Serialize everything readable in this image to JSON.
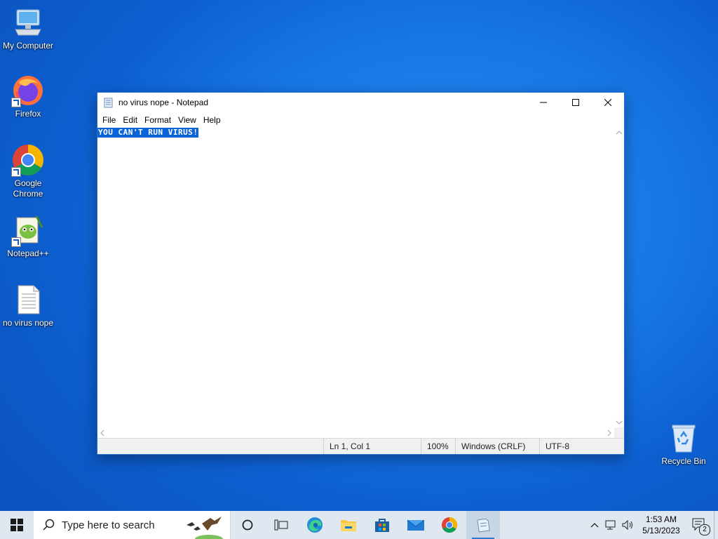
{
  "desktop": {
    "icons": [
      {
        "label": "My Computer"
      },
      {
        "label": "Firefox"
      },
      {
        "label": "Google Chrome"
      },
      {
        "label": "Notepad++"
      },
      {
        "label": "no virus nope"
      },
      {
        "label": "Recycle Bin"
      }
    ]
  },
  "notepad": {
    "title": "no virus nope - Notepad",
    "menu": [
      "File",
      "Edit",
      "Format",
      "View",
      "Help"
    ],
    "content": "YOU CAN'T RUN VIRUS!",
    "status": {
      "position": "Ln 1, Col 1",
      "zoom": "100%",
      "line_ending": "Windows (CRLF)",
      "encoding": "UTF-8"
    }
  },
  "taskbar": {
    "search_placeholder": "Type here to search",
    "clock_time": "1:53 AM",
    "clock_date": "5/13/2023",
    "notification_count": "2"
  },
  "colors": {
    "selection": "#0a64d7",
    "desktop": "#1877e6",
    "taskbar": "#dfe7f0"
  }
}
